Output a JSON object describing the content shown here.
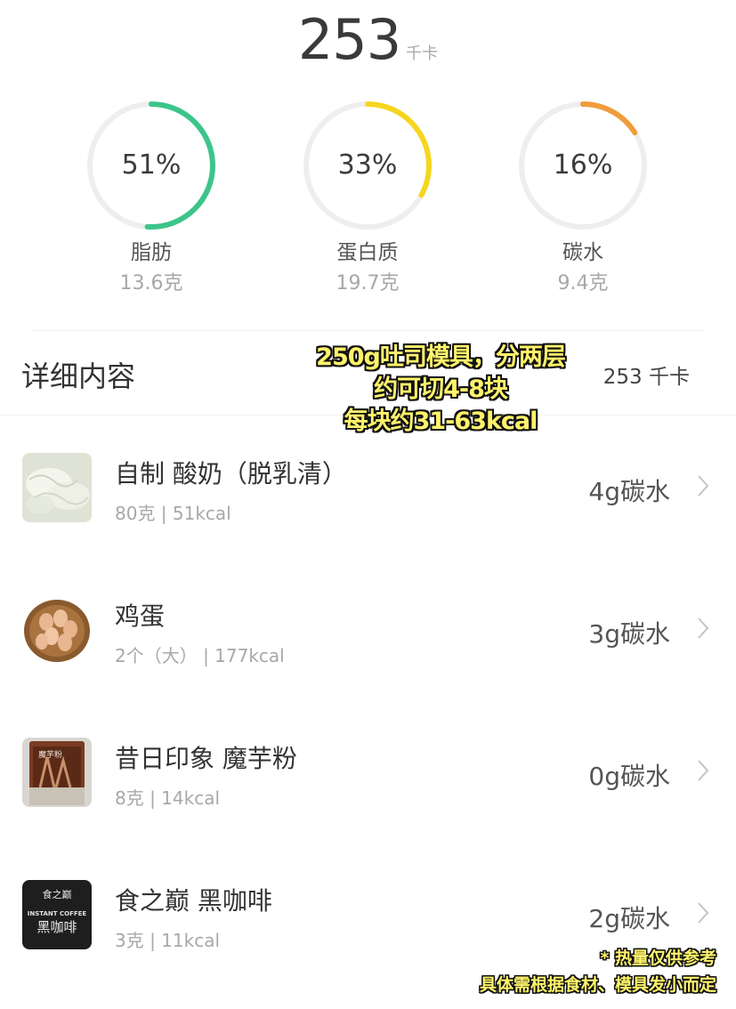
{
  "summary": {
    "total_kcal": "253",
    "unit": "千卡"
  },
  "macros": [
    {
      "percent": "51%",
      "fraction": 0.51,
      "name": "脂肪",
      "grams": "13.6克",
      "color": "#3cc58a"
    },
    {
      "percent": "33%",
      "fraction": 0.33,
      "name": "蛋白质",
      "grams": "19.7克",
      "color": "#f5d61e"
    },
    {
      "percent": "16%",
      "fraction": 0.16,
      "name": "碳水",
      "grams": "9.4克",
      "color": "#ef9c3b"
    }
  ],
  "details": {
    "title": "详细内容",
    "total": "253 千卡"
  },
  "overlay": {
    "lines": [
      "250g吐司模具，分两层",
      "约可切4-8块",
      "每块约31-63kcal"
    ]
  },
  "items": [
    {
      "name": "自制 酸奶（脱乳清）",
      "sub": "80克 | 51kcal",
      "carb": "4g碳水",
      "icon": "yogurt-thumbnail"
    },
    {
      "name": "鸡蛋",
      "sub": "2个（大） | 177kcal",
      "carb": "3g碳水",
      "icon": "eggs-thumbnail"
    },
    {
      "name": "昔日印象 魔芋粉",
      "sub": "8克 | 14kcal",
      "carb": "0g碳水",
      "icon": "konjac-powder-thumbnail",
      "label": "魔芋粉"
    },
    {
      "name": "食之巅 黑咖啡",
      "sub": "3克 | 11kcal",
      "carb": "2g碳水",
      "icon": "black-coffee-thumbnail",
      "brand": "食之巅",
      "product_en": "INSTANT COFFEE",
      "product_cn": "黑咖啡"
    }
  ],
  "footnote": {
    "line1": "* 热量仅供参考",
    "line2": "具体需根据食材、模具发小而定"
  }
}
